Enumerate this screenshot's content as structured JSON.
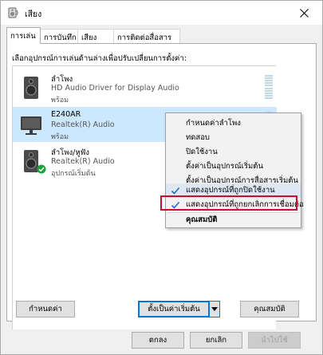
{
  "window": {
    "title": "เสียง",
    "close_icon": "close-icon",
    "title_icon": "speaker-icon"
  },
  "tabs": [
    {
      "label": "การเล่น",
      "active": true
    },
    {
      "label": "การบันทึก",
      "active": false
    },
    {
      "label": "เสียง",
      "active": false
    },
    {
      "label": "การติดต่อสื่อสาร",
      "active": false
    }
  ],
  "playback": {
    "instruction": "เลือกอุปกรณ์การเล่นด้านล่างเพื่อปรับเปลี่ยนการตั้งค่า:",
    "devices": [
      {
        "name": "ลำโพง",
        "description": "HD Audio Driver for Display Audio",
        "status": "พร้อม",
        "icon": "speaker-device-icon",
        "selected": false
      },
      {
        "name": "E240AR",
        "description": "Realtek(R) Audio",
        "status": "พร้อม",
        "icon": "monitor-device-icon",
        "selected": true
      },
      {
        "name": "ลำโพง/หูฟัง",
        "description": "Realtek(R) Audio",
        "status": "อุปกรณ์เริ่มต้น",
        "icon": "speaker-device-icon",
        "default_badge_icon": "green-check-icon",
        "selected": false
      }
    ]
  },
  "context_menu": {
    "items": [
      {
        "label": "กำหนดค่าลำโพง",
        "checked": false,
        "highlighted": false,
        "bold": false
      },
      {
        "label": "ทดสอบ",
        "checked": false,
        "highlighted": false,
        "bold": false
      },
      {
        "label": "ปิดใช้งาน",
        "checked": false,
        "highlighted": false,
        "bold": false
      },
      {
        "label": "ตั้งค่าเป็นอุปกรณ์เริ่มต้น",
        "checked": false,
        "highlighted": false,
        "bold": false
      },
      {
        "label": "ตั้งค่าเป็นอุปกรณ์การสื่อสารเริ่มต้น",
        "checked": false,
        "highlighted": false,
        "bold": false
      },
      {
        "label": "แสดงอุปกรณ์ที่ถูกปิดใช้งาน",
        "checked": true,
        "highlighted": true,
        "bold": false
      },
      {
        "label": "แสดงอุปกรณ์ที่ถูกยกเลิกการเชื่อมต่อ",
        "checked": true,
        "highlighted": false,
        "bold": false
      },
      {
        "label": "คุณสมบัติ",
        "checked": false,
        "highlighted": false,
        "bold": true
      }
    ],
    "annotation_color": "#c8102e"
  },
  "panel_buttons": {
    "configure": "กำหนดค่า",
    "set_default": "ตั้งเป็นค่าเริ่มต้น",
    "properties": "คุณสมบัติ"
  },
  "dialog_buttons": {
    "ok": "ตกลง",
    "cancel": "ยกเลิก",
    "apply": "นำไปใช้"
  },
  "colors": {
    "selection": "#cce8ff",
    "accent": "#0078d7",
    "check": "#1a6fd1"
  }
}
